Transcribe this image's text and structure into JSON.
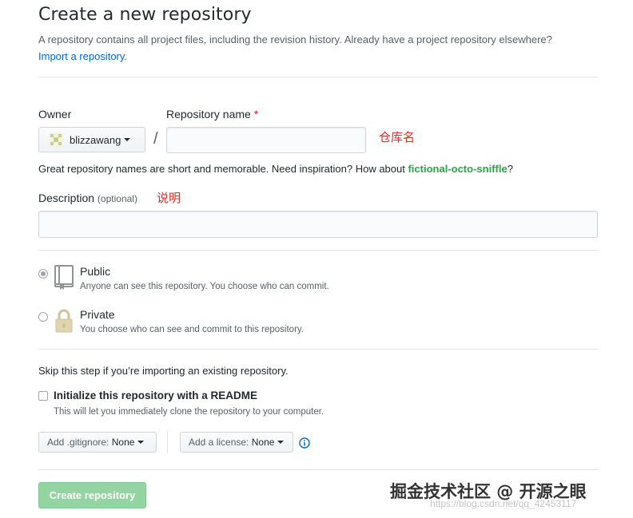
{
  "header": {
    "title": "Create a new repository",
    "subtitle": "A repository contains all project files, including the revision history. Already have a project repository elsewhere?",
    "import_link": "Import a repository",
    "import_suffix": "."
  },
  "owner": {
    "label": "Owner",
    "value": "blizzawang"
  },
  "repo_name": {
    "label": "Repository name",
    "required_mark": "*",
    "value": "",
    "annotation": "仓库名"
  },
  "hint": {
    "text": "Great repository names are short and memorable. Need inspiration? How about ",
    "suggestion": "fictional-octo-sniffle",
    "suffix": "?"
  },
  "description": {
    "label": "Description",
    "optional": "(optional)",
    "value": "",
    "annotation": "说明"
  },
  "visibility": {
    "public": {
      "title": "Public",
      "desc": "Anyone can see this repository. You choose who can commit.",
      "selected": true
    },
    "private": {
      "title": "Private",
      "desc": "You choose who can see and commit to this repository.",
      "selected": false
    }
  },
  "init": {
    "skip_text": "Skip this step if you’re importing an existing repository.",
    "readme_label": "Initialize this repository with a README",
    "readme_note": "This will let you immediately clone the repository to your computer.",
    "readme_checked": false
  },
  "gitignore": {
    "label": "Add .gitignore:",
    "value": "None"
  },
  "license": {
    "label": "Add a license:",
    "value": "None"
  },
  "submit": {
    "label": "Create repository"
  },
  "watermark": {
    "text": "掘金技术社区 @ 开源之眼",
    "url": "https://blog.csdn.net/qq_42453117"
  },
  "colors": {
    "link": "#0366d6",
    "suggestion": "#28a745",
    "annotation": "#d0342c",
    "create_button": "#94d3a2"
  },
  "icons": {
    "owner_avatar": "identicon",
    "public": "repo-book-icon",
    "private": "lock-icon",
    "license_info": "info-icon"
  }
}
